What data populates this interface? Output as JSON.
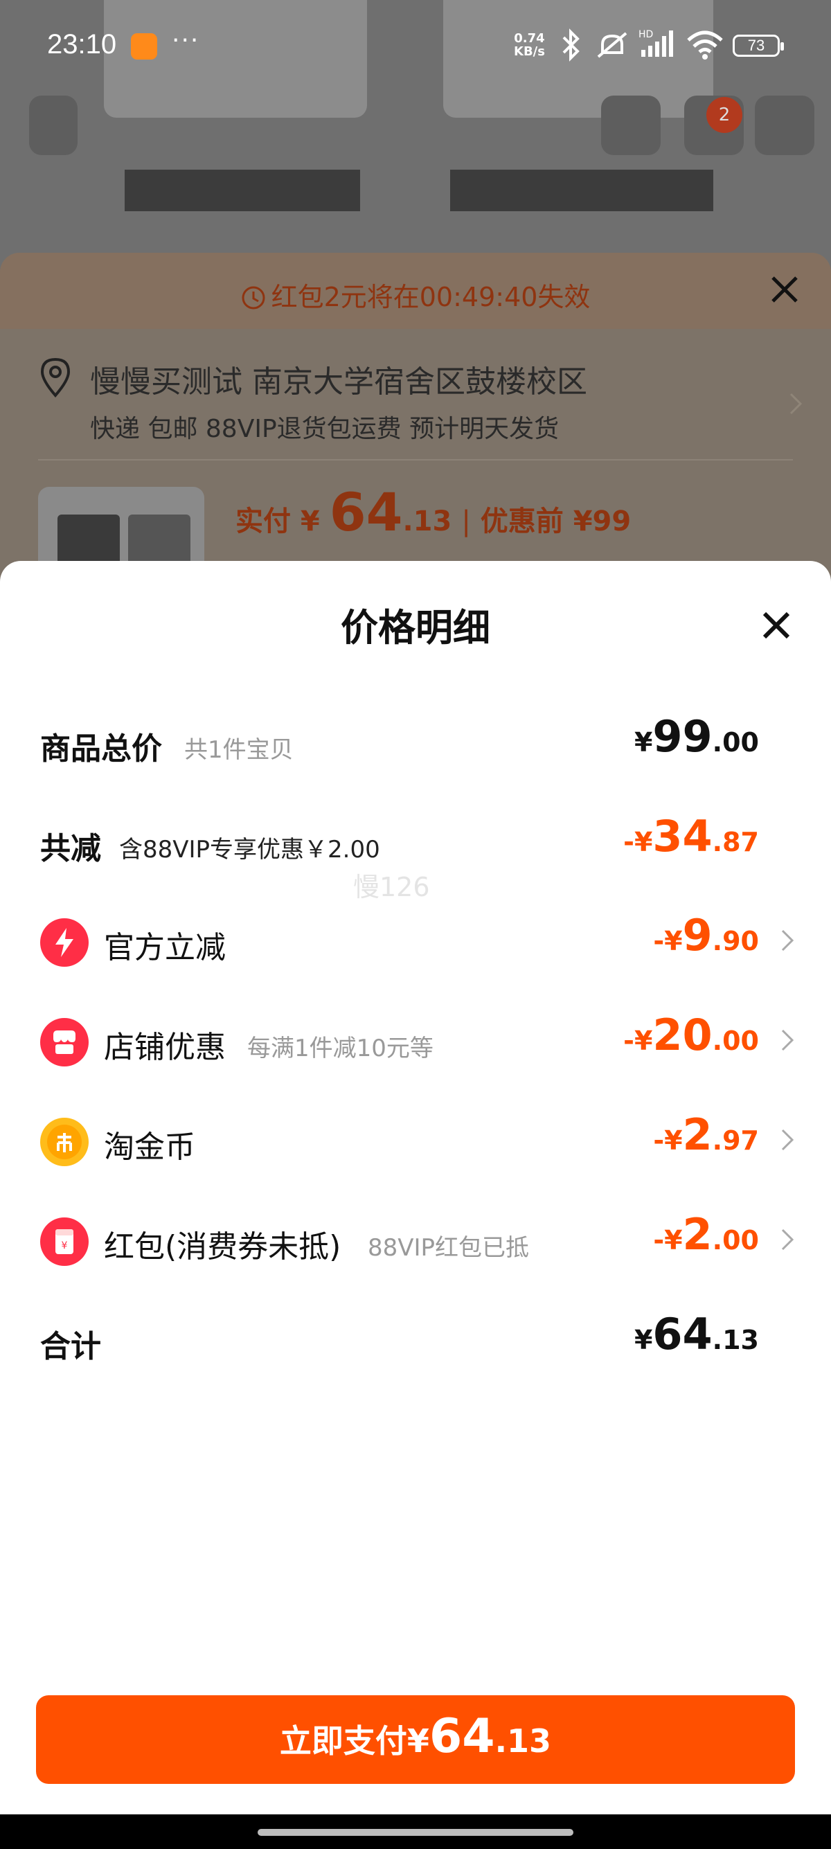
{
  "status_bar": {
    "time": "23:10",
    "dots": "···",
    "net_speed_value": "0.74",
    "net_speed_unit": "KB/s",
    "battery": "73",
    "icons": [
      "bluetooth-icon",
      "mute-icon",
      "signal-icon",
      "wifi-icon",
      "battery-icon"
    ]
  },
  "background": {
    "cart_badge": "2"
  },
  "order": {
    "redpacket_timer": "红包2元将在00:49:40失效",
    "address_line1": "慢慢买测试 南京大学宿舍区鼓楼校区",
    "address_line2": "快递 包邮 88VIP退货包运费 预计明天发货",
    "pay_label": "实付 ¥ ",
    "pay_int": "64",
    "pay_dec": ".13",
    "sep": "|",
    "before_discount": "优惠前 ¥99"
  },
  "panel": {
    "title": "价格明细",
    "watermark": "慢126",
    "rows": [
      {
        "label": "商品总价",
        "sub": "共1件宝贝",
        "cur": "¥",
        "int": "99",
        "dec": ".00"
      },
      {
        "label": "共减",
        "sub": "含88VIP专享优惠￥2.00",
        "cur": "-¥",
        "int": "34",
        "dec": ".87"
      },
      {
        "label": "官方立减",
        "sub": "",
        "cur": "-¥",
        "int": "9",
        "dec": ".90"
      },
      {
        "label": "店铺优惠",
        "sub": "每满1件减10元等",
        "cur": "-¥",
        "int": "20",
        "dec": ".00"
      },
      {
        "label": "淘金币",
        "sub": "",
        "cur": "-¥",
        "int": "2",
        "dec": ".97"
      },
      {
        "label": "红包(消费券未抵)",
        "sub": "88VIP红包已抵",
        "cur": "-¥",
        "int": "2",
        "dec": ".00"
      },
      {
        "label": "合计",
        "sub": "",
        "cur": "¥",
        "int": "64",
        "dec": ".13"
      }
    ],
    "pay_button": {
      "label": "立即支付",
      "cur": "¥",
      "int": "64",
      "dec": ".13"
    }
  },
  "colors": {
    "accent": "#ff5000",
    "text": "#111111",
    "muted": "#999999"
  }
}
